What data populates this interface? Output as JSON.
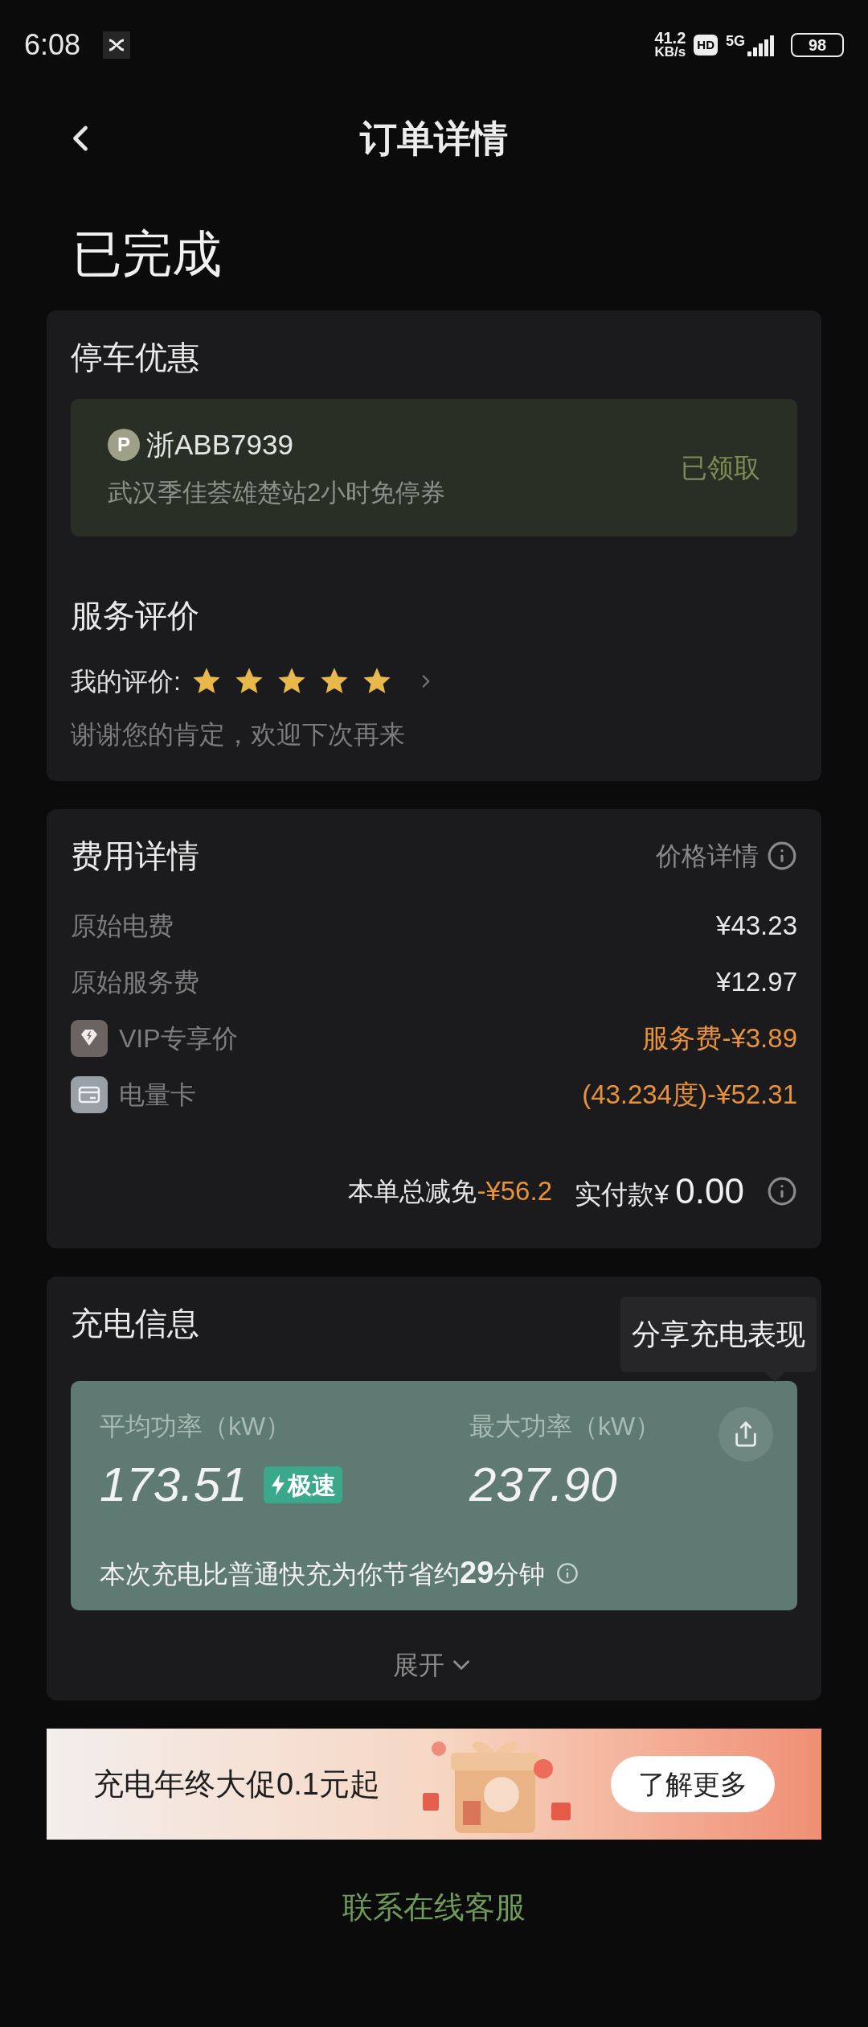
{
  "status_bar": {
    "time": "6:08",
    "speed_value": "41.2",
    "speed_unit": "KB/s",
    "hd": "HD",
    "network": "5G",
    "battery": "98"
  },
  "header": {
    "title": "订单详情"
  },
  "order_status": "已完成",
  "parking": {
    "title": "停车优惠",
    "coupon": {
      "marker": "P",
      "plate": "浙ABB7939",
      "description": "武汉季佳荟雄楚站2小时免停券",
      "status": "已领取"
    }
  },
  "rating": {
    "title": "服务评价",
    "label": "我的评价:",
    "stars": 5,
    "message": "谢谢您的肯定，欢迎下次再来"
  },
  "fees": {
    "title": "费用详情",
    "link": "价格详情",
    "rows": [
      {
        "kind": "plain",
        "label": "原始电费",
        "value": "¥43.23"
      },
      {
        "kind": "plain",
        "label": "原始服务费",
        "value": "¥12.97"
      },
      {
        "kind": "vip",
        "label": "VIP专享价",
        "value": "服务费-¥3.89"
      },
      {
        "kind": "card",
        "label": "电量卡",
        "value": "(43.234度)-¥52.31"
      }
    ],
    "discount_label": "本单总减免",
    "discount_value": "-¥56.2",
    "paid_label": "实付款¥",
    "paid_value": "0.00"
  },
  "charging": {
    "title": "充电信息",
    "tooltip": "分享充电表现",
    "avg_label": "平均功率（kW）",
    "avg_value": "173.51",
    "badge": "极速",
    "max_label": "最大功率（kW）",
    "max_value": "237.90",
    "saving": "本次充电比普通快充为你节省约**29**分钟",
    "expand": "展开"
  },
  "banner": {
    "text": "充电年终大促0.1元起",
    "button": "了解更多"
  },
  "contact": "联系在线客服"
}
